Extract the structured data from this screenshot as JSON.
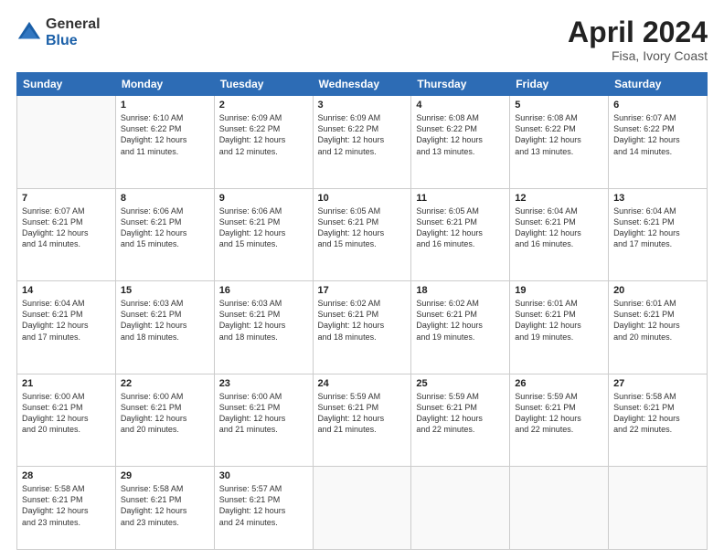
{
  "header": {
    "logo_general": "General",
    "logo_blue": "Blue",
    "month_year": "April 2024",
    "location": "Fisa, Ivory Coast"
  },
  "days_of_week": [
    "Sunday",
    "Monday",
    "Tuesday",
    "Wednesday",
    "Thursday",
    "Friday",
    "Saturday"
  ],
  "weeks": [
    [
      {
        "day": "",
        "info": ""
      },
      {
        "day": "1",
        "info": "Sunrise: 6:10 AM\nSunset: 6:22 PM\nDaylight: 12 hours\nand 11 minutes."
      },
      {
        "day": "2",
        "info": "Sunrise: 6:09 AM\nSunset: 6:22 PM\nDaylight: 12 hours\nand 12 minutes."
      },
      {
        "day": "3",
        "info": "Sunrise: 6:09 AM\nSunset: 6:22 PM\nDaylight: 12 hours\nand 12 minutes."
      },
      {
        "day": "4",
        "info": "Sunrise: 6:08 AM\nSunset: 6:22 PM\nDaylight: 12 hours\nand 13 minutes."
      },
      {
        "day": "5",
        "info": "Sunrise: 6:08 AM\nSunset: 6:22 PM\nDaylight: 12 hours\nand 13 minutes."
      },
      {
        "day": "6",
        "info": "Sunrise: 6:07 AM\nSunset: 6:22 PM\nDaylight: 12 hours\nand 14 minutes."
      }
    ],
    [
      {
        "day": "7",
        "info": "Sunrise: 6:07 AM\nSunset: 6:21 PM\nDaylight: 12 hours\nand 14 minutes."
      },
      {
        "day": "8",
        "info": "Sunrise: 6:06 AM\nSunset: 6:21 PM\nDaylight: 12 hours\nand 15 minutes."
      },
      {
        "day": "9",
        "info": "Sunrise: 6:06 AM\nSunset: 6:21 PM\nDaylight: 12 hours\nand 15 minutes."
      },
      {
        "day": "10",
        "info": "Sunrise: 6:05 AM\nSunset: 6:21 PM\nDaylight: 12 hours\nand 15 minutes."
      },
      {
        "day": "11",
        "info": "Sunrise: 6:05 AM\nSunset: 6:21 PM\nDaylight: 12 hours\nand 16 minutes."
      },
      {
        "day": "12",
        "info": "Sunrise: 6:04 AM\nSunset: 6:21 PM\nDaylight: 12 hours\nand 16 minutes."
      },
      {
        "day": "13",
        "info": "Sunrise: 6:04 AM\nSunset: 6:21 PM\nDaylight: 12 hours\nand 17 minutes."
      }
    ],
    [
      {
        "day": "14",
        "info": "Sunrise: 6:04 AM\nSunset: 6:21 PM\nDaylight: 12 hours\nand 17 minutes."
      },
      {
        "day": "15",
        "info": "Sunrise: 6:03 AM\nSunset: 6:21 PM\nDaylight: 12 hours\nand 18 minutes."
      },
      {
        "day": "16",
        "info": "Sunrise: 6:03 AM\nSunset: 6:21 PM\nDaylight: 12 hours\nand 18 minutes."
      },
      {
        "day": "17",
        "info": "Sunrise: 6:02 AM\nSunset: 6:21 PM\nDaylight: 12 hours\nand 18 minutes."
      },
      {
        "day": "18",
        "info": "Sunrise: 6:02 AM\nSunset: 6:21 PM\nDaylight: 12 hours\nand 19 minutes."
      },
      {
        "day": "19",
        "info": "Sunrise: 6:01 AM\nSunset: 6:21 PM\nDaylight: 12 hours\nand 19 minutes."
      },
      {
        "day": "20",
        "info": "Sunrise: 6:01 AM\nSunset: 6:21 PM\nDaylight: 12 hours\nand 20 minutes."
      }
    ],
    [
      {
        "day": "21",
        "info": "Sunrise: 6:00 AM\nSunset: 6:21 PM\nDaylight: 12 hours\nand 20 minutes."
      },
      {
        "day": "22",
        "info": "Sunrise: 6:00 AM\nSunset: 6:21 PM\nDaylight: 12 hours\nand 20 minutes."
      },
      {
        "day": "23",
        "info": "Sunrise: 6:00 AM\nSunset: 6:21 PM\nDaylight: 12 hours\nand 21 minutes."
      },
      {
        "day": "24",
        "info": "Sunrise: 5:59 AM\nSunset: 6:21 PM\nDaylight: 12 hours\nand 21 minutes."
      },
      {
        "day": "25",
        "info": "Sunrise: 5:59 AM\nSunset: 6:21 PM\nDaylight: 12 hours\nand 22 minutes."
      },
      {
        "day": "26",
        "info": "Sunrise: 5:59 AM\nSunset: 6:21 PM\nDaylight: 12 hours\nand 22 minutes."
      },
      {
        "day": "27",
        "info": "Sunrise: 5:58 AM\nSunset: 6:21 PM\nDaylight: 12 hours\nand 22 minutes."
      }
    ],
    [
      {
        "day": "28",
        "info": "Sunrise: 5:58 AM\nSunset: 6:21 PM\nDaylight: 12 hours\nand 23 minutes."
      },
      {
        "day": "29",
        "info": "Sunrise: 5:58 AM\nSunset: 6:21 PM\nDaylight: 12 hours\nand 23 minutes."
      },
      {
        "day": "30",
        "info": "Sunrise: 5:57 AM\nSunset: 6:21 PM\nDaylight: 12 hours\nand 24 minutes."
      },
      {
        "day": "",
        "info": ""
      },
      {
        "day": "",
        "info": ""
      },
      {
        "day": "",
        "info": ""
      },
      {
        "day": "",
        "info": ""
      }
    ]
  ]
}
